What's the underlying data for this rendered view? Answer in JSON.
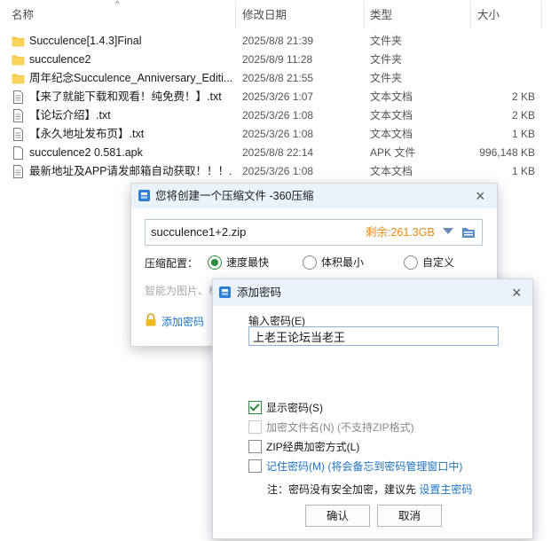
{
  "explorer": {
    "columns": {
      "name": "名称",
      "modified": "修改日期",
      "type": "类型",
      "size": "大小"
    },
    "sort_indicator": "^",
    "files": [
      {
        "icon": "folder-icon",
        "name": "Succulence[1.4.3]Final",
        "modified": "2025/8/8 21:39",
        "type": "文件夹",
        "size": ""
      },
      {
        "icon": "folder-icon",
        "name": "succulence2",
        "modified": "2025/8/9 11:28",
        "type": "文件夹",
        "size": ""
      },
      {
        "icon": "folder-icon",
        "name": "周年纪念Succulence_Anniversary_Editi...",
        "modified": "2025/8/8 21:55",
        "type": "文件夹",
        "size": ""
      },
      {
        "icon": "text-file-icon",
        "name": "【来了就能下载和观看！纯免费！】.txt",
        "modified": "2025/3/26 1:07",
        "type": "文本文档",
        "size": "2 KB"
      },
      {
        "icon": "text-file-icon",
        "name": "【论坛介绍】.txt",
        "modified": "2025/3/26 1:08",
        "type": "文本文档",
        "size": "2 KB"
      },
      {
        "icon": "text-file-icon",
        "name": "【永久地址发布页】.txt",
        "modified": "2025/3/26 1:08",
        "type": "文本文档",
        "size": "1 KB"
      },
      {
        "icon": "apk-file-icon",
        "name": "succulence2 0.581.apk",
        "modified": "2025/8/8 22:14",
        "type": "APK 文件",
        "size": "996,148 KB"
      },
      {
        "icon": "text-file-icon",
        "name": "最新地址及APP请发邮箱自动获取！！！....",
        "modified": "2025/3/26 1:08",
        "type": "文本文档",
        "size": "1 KB"
      }
    ]
  },
  "zip_dialog": {
    "title": "您将创建一个压缩文件 -360压缩",
    "close": "×",
    "file_name": "succulence1+2.zip",
    "free_space": "剩余:261.3GB",
    "compress_label": "压缩配置：",
    "options": [
      {
        "label": "速度最快",
        "selected": true
      },
      {
        "label": "体积最小",
        "selected": false
      },
      {
        "label": "自定义",
        "selected": false
      }
    ],
    "hint": "智能为图片、标",
    "add_password": "添加密码"
  },
  "password_dialog": {
    "title": "添加密码",
    "close": "×",
    "input_label": "输入密码(E)",
    "password_value": "上老王论坛当老王",
    "show_password": {
      "label": "显示密码(S)",
      "checked": true
    },
    "encrypt_names": {
      "label": "加密文件名(N) (不支持ZIP格式)",
      "checked": false
    },
    "zip_classic": {
      "label": "ZIP经典加密方式(L)",
      "checked": false
    },
    "remember": {
      "label": "记住密码(M) (将会备忘到密码管理窗口中)",
      "checked": false
    },
    "note_text": "注：密码没有安全加密，建议先 ",
    "note_link": "设置主密码",
    "ok": "确认",
    "cancel": "取消"
  },
  "colors": {
    "accent_link": "#1d74c9",
    "free_space": "#e88a14",
    "radio_check": "#2a8a3a",
    "folder": "#f4c542"
  }
}
